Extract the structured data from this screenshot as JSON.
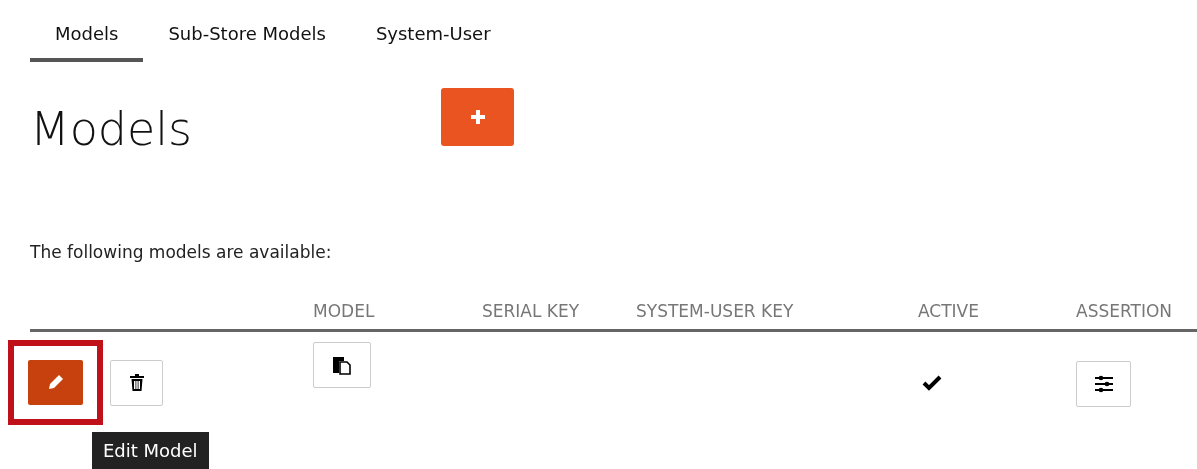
{
  "tabs": [
    {
      "label": "Models",
      "selected": true
    },
    {
      "label": "Sub-Store Models",
      "selected": false
    },
    {
      "label": "System-User",
      "selected": false
    }
  ],
  "heading": "Models",
  "intro": "The following models are available:",
  "table": {
    "columns": [
      "MODEL",
      "SERIAL KEY",
      "SYSTEM-USER KEY",
      "ACTIVE",
      "ASSERTION"
    ],
    "rows": [
      {
        "active": true,
        "edit_highlighted": true
      }
    ]
  },
  "tooltip": "Edit Model"
}
